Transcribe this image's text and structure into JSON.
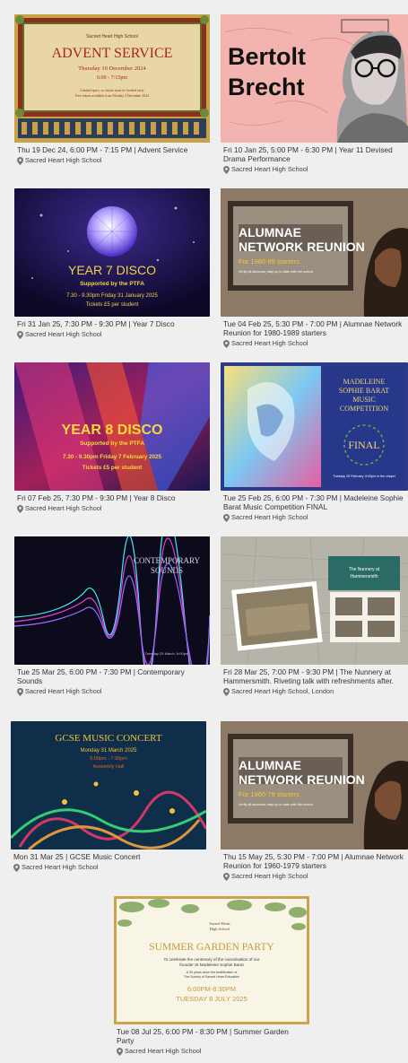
{
  "events": [
    {
      "title": "Thu 19 Dec 24, 6:00 PM - 7:15 PM | Advent Service",
      "location": "Sacred Heart High School",
      "image": {
        "school": "Sacred Heart High School",
        "heading": "ADVENT SERVICE",
        "date": "Thursday 19 December 2024",
        "time": "6:00 - 7:15pm",
        "note1": "Limited space, so entries must be booked early",
        "note2": "Free tickets available from Monday 2 December 2024"
      }
    },
    {
      "title": "Fri 10 Jan 25, 5:00 PM - 6:30 PM | Year 11 Devised Drama Performance",
      "location": "Sacred Heart High School",
      "image": {
        "line1": "Bertolt",
        "line2": "Brecht"
      }
    },
    {
      "title": "Fri 31 Jan 25, 7:30 PM - 9:30 PM | Year 7 Disco",
      "location": "Sacred Heart High School",
      "image": {
        "heading": "YEAR 7 DISCO",
        "sub": "Supported by the PTFA",
        "when": "7.30 - 9.30pm Friday 31 January 2025",
        "price": "Tickets £5 per student"
      }
    },
    {
      "title": "Tue 04 Feb 25, 5:30 PM - 7:00 PM | Alumnae Network Reunion for 1980-1989 starters",
      "location": "Sacred Heart High School",
      "image": {
        "line1": "ALUMNAE",
        "line2": "NETWORK REUNION",
        "sub": "For 1980-89 starters",
        "note": "Verify all alumnae; stay up to date with the school"
      }
    },
    {
      "title": "Fri 07 Feb 25, 7:30 PM - 9:30 PM | Year 8 Disco",
      "location": "Sacred Heart High School",
      "image": {
        "heading": "YEAR 8 DISCO",
        "sub": "Supported by the PTFA",
        "when": "7.30 - 9.30pm Friday 7 February 2025",
        "price": "Tickets £5 per student"
      }
    },
    {
      "title": "Tue 25 Feb 25, 6:00 PM - 7:30 PM | Madeleine Sophie Barat Music Competition FINAL",
      "location": "Sacred Heart High School",
      "image": {
        "l1": "MADELEINE",
        "l2": "SOPHIE BARAT",
        "l3": "MUSIC",
        "l4": "COMPETITION",
        "final": "FINAL",
        "date": "Tuesday 25 February, 6:00pm in the chapel"
      }
    },
    {
      "title": "Tue 25 Mar 25, 6:00 PM - 7:30 PM | Contemporary Sounds",
      "location": "Sacred Heart High School",
      "image": {
        "l1": "CONTEMPORARY",
        "l2": "SOUNDS",
        "date": "Tuesday 25 March, 6:00pm"
      }
    },
    {
      "title": "Fri 28 Mar 25, 7:00 PM - 9:30 PM | The Nunnery at Hammersmith. Riveting talk with refreshments after.",
      "location": "Sacred Heart High School, London",
      "image": {
        "l1": "The Nunnery at",
        "l2": "Hammersmith"
      }
    },
    {
      "title": "Mon 31 Mar 25 | GCSE Music Concert",
      "location": "Sacred Heart High School",
      "image": {
        "heading": "GCSE MUSIC CONCERT",
        "date": "Monday 31 March 2025",
        "time": "6:00pm - 7:30pm",
        "venue": "Assembly Hall"
      }
    },
    {
      "title": "Thu 15 May 25, 5:30 PM - 7:00 PM | Alumnae Network Reunion for 1960-1979 starters",
      "location": "Sacred Heart High School",
      "image": {
        "line1": "ALUMNAE",
        "line2": "NETWORK REUNION",
        "sub": "For 1960-79 starters",
        "note": "Verify all alumnae; stay up to date with the school"
      }
    },
    {
      "title": "Tue 08 Jul 25, 6:00 PM - 8:30 PM | Summer Garden Party",
      "location": "Sacred Heart High School",
      "image": {
        "school1": "Sacred Heart",
        "school2": "High School",
        "heading": "SUMMER GARDEN PARTY",
        "t1": "To celebrate the centenary of the canonisation of our",
        "t2": "founder St Madeleine Sophie Barat",
        "t3": "& 50 years since the beatification of",
        "t4": "The Society of Sacred Heart Education",
        "time": "6:00PM-8:30PM",
        "date": "TUESDAY 8 JULY 2025"
      }
    }
  ],
  "colors": {
    "text": "#333333",
    "background": "#efefef",
    "pin": "#777777"
  }
}
